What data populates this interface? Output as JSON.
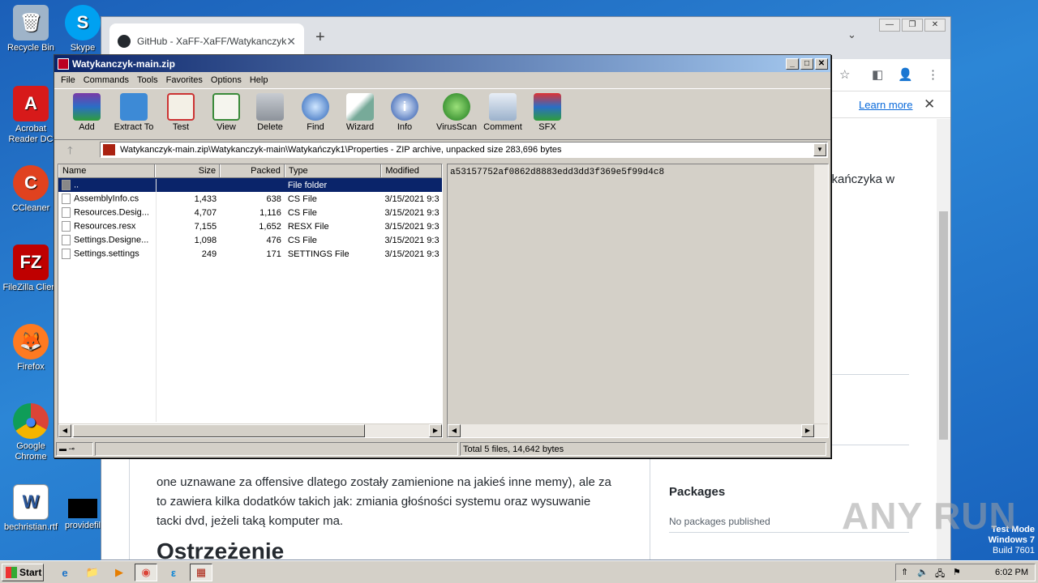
{
  "desktop": {
    "icons": [
      {
        "label": "Recycle Bin",
        "glyph": "🗑"
      },
      {
        "label": "Acrobat Reader DC",
        "glyph": "A"
      },
      {
        "label": "CCleaner",
        "glyph": "C"
      },
      {
        "label": "FileZilla Client",
        "glyph": "FZ"
      },
      {
        "label": "Firefox",
        "glyph": "🦊"
      },
      {
        "label": "Google Chrome",
        "glyph": "●"
      },
      {
        "label": "bechristian.rtf",
        "glyph": "W"
      },
      {
        "label": "Skype",
        "glyph": "S"
      },
      {
        "label": "providefil",
        "glyph": ""
      }
    ]
  },
  "chrome": {
    "tab_title": "GitHub - XaFF-XaFF/Watykanczyk: R",
    "tab_close": "✕",
    "new_tab": "+",
    "tabs_dropdown": "⌄",
    "window_controls": [
      "—",
      "❐",
      "✕"
    ],
    "toolbar_icons": [
      "☆",
      "◧",
      "👤",
      "⋮"
    ],
    "learn_more": "Learn more",
    "info_close": "✕",
    "snippet": "ykańczyka w",
    "body_line1": "one uznawane za offensive dlatego zostały zamienione na jakieś inne memy), ale za",
    "body_line2": "to zawiera kilka dodatków takich jak: zmiania głośności systemu oraz wysuwanie",
    "body_line3": "tacki dvd, jeżeli taką komputer ma.",
    "heading": "Ostrzeżenie",
    "packages_heading": "Packages",
    "packages_sub": "No packages published"
  },
  "winrar": {
    "title": "Watykanczyk-main.zip",
    "title_controls": [
      "_",
      "□",
      "✕"
    ],
    "menu": [
      "File",
      "Commands",
      "Tools",
      "Favorites",
      "Options",
      "Help"
    ],
    "toolbar": [
      {
        "label": "Add",
        "icon": "archive-add-icon"
      },
      {
        "label": "Extract To",
        "icon": "folder-extract-icon"
      },
      {
        "label": "Test",
        "icon": "test-clipboard-icon"
      },
      {
        "label": "View",
        "icon": "book-view-icon"
      },
      {
        "label": "Delete",
        "icon": "trash-icon"
      },
      {
        "label": "Find",
        "icon": "magnifier-icon"
      },
      {
        "label": "Wizard",
        "icon": "wand-icon"
      },
      {
        "label": "Info",
        "icon": "info-icon"
      },
      {
        "label": "VirusScan",
        "icon": "bug-icon"
      },
      {
        "label": "Comment",
        "icon": "comment-icon"
      },
      {
        "label": "SFX",
        "icon": "sfx-icon"
      }
    ],
    "up_arrow": "🡑",
    "address": "Watykanczyk-main.zip\\Watykanczyk-main\\Watykańczyk1\\Properties - ZIP archive, unpacked size 283,696 bytes",
    "columns": [
      "Name",
      "Size",
      "Packed",
      "Type",
      "Modified"
    ],
    "files": [
      {
        "name": "..",
        "size": "",
        "packed": "",
        "type": "File folder",
        "modified": "",
        "selected": true
      },
      {
        "name": "AssemblyInfo.cs",
        "size": "1,433",
        "packed": "638",
        "type": "CS File",
        "modified": "3/15/2021 9:3"
      },
      {
        "name": "Resources.Desig...",
        "size": "4,707",
        "packed": "1,116",
        "type": "CS File",
        "modified": "3/15/2021 9:3"
      },
      {
        "name": "Resources.resx",
        "size": "7,155",
        "packed": "1,652",
        "type": "RESX File",
        "modified": "3/15/2021 9:3"
      },
      {
        "name": "Settings.Designe...",
        "size": "1,098",
        "packed": "476",
        "type": "CS File",
        "modified": "3/15/2021 9:3"
      },
      {
        "name": "Settings.settings",
        "size": "249",
        "packed": "171",
        "type": "SETTINGS File",
        "modified": "3/15/2021 9:3"
      }
    ],
    "preview_hash": "a53157752af0862d8883edd3dd3f369e5f99d4c8",
    "status_total": "Total 5 files, 14,642 bytes",
    "status_icons": "▬ ⊸"
  },
  "taskbar": {
    "start": "Start",
    "items": [
      "e",
      "📁",
      "▶",
      "◉",
      "ε",
      "▦"
    ],
    "clock": "6:02 PM",
    "tray_icons": [
      "⇑",
      "🔈",
      "🖧",
      "⚑"
    ]
  },
  "testmode": {
    "line1": "Test Mode",
    "line2": "Windows 7",
    "line3": "Build 7601"
  },
  "watermark": "ANY RUN"
}
